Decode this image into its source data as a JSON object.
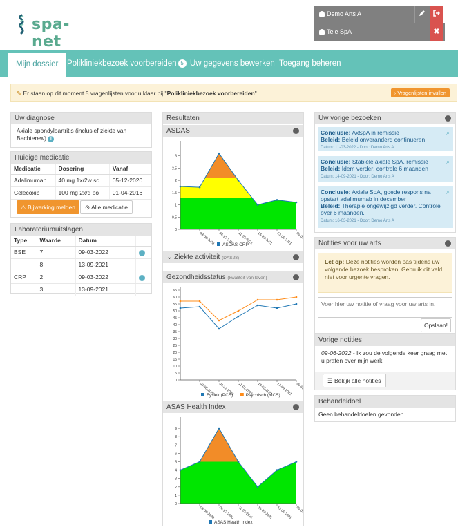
{
  "header": {
    "logo_text": "spa-net",
    "users": [
      {
        "name": "Demo Arts A",
        "actions": [
          "pencil-icon",
          "logout-icon"
        ]
      },
      {
        "name": "Tele SpA",
        "actions": [
          "close-icon"
        ]
      }
    ],
    "colors": {
      "user_bg": "#808080",
      "action_red": "#d9534f",
      "brand": "#5aaa8f"
    }
  },
  "nav": {
    "tabs": [
      {
        "label": "Mijn dossier",
        "active": true
      },
      {
        "label": "Polikliniekbezoek voorbereiden",
        "badge": "5"
      },
      {
        "label": "Uw gegevens bewerken"
      },
      {
        "label": "Toegang beheren"
      }
    ],
    "color": "#64c2b8"
  },
  "alert": {
    "text_before": "Er staan op dit moment 5 vragenlijsten voor u klaar bij \"",
    "text_bold": "Polikliniekbezoek voorbereiden",
    "text_after": "\".",
    "button": "Vragenlijsten invullen"
  },
  "diagnose": {
    "title": "Uw diagnose",
    "text": "Axiale spondyloartritis (inclusief ziekte van Bechterew)"
  },
  "medicatie": {
    "title": "Huidige medicatie",
    "headers": [
      "Medicatie",
      "Dosering",
      "Vanaf"
    ],
    "rows": [
      [
        "Adalimumab",
        "40 mg 1x/2w sc",
        "05-12-2020"
      ],
      [
        "Celecoxib",
        "100 mg 2x/d po",
        "01-04-2016"
      ]
    ],
    "btn_report": "Bijwerking melden",
    "btn_all": "Alle medicatie"
  },
  "lab": {
    "title": "Laboratoriumuitslagen",
    "headers": [
      "Type",
      "Waarde",
      "Datum"
    ],
    "rows": [
      [
        "BSE",
        "7",
        "09-03-2022"
      ],
      [
        "",
        "8",
        "13-09-2021"
      ],
      [
        "CRP",
        "2",
        "09-03-2022"
      ],
      [
        "",
        "3",
        "13-09-2021"
      ]
    ]
  },
  "results": {
    "title": "Resultaten",
    "dates": [
      "03-08-2020",
      "04-12-2020",
      "11-01-2021",
      "16-03-2021",
      "13-09-2021",
      "09-03-2022"
    ],
    "asdas_title": "ASDAS",
    "asdas_legend": "ASDAS-CRP",
    "ziekte_title": "Ziekte activiteit",
    "ziekte_sub": "(DAS28)",
    "gezondheid_title": "Gezondheidsstatus",
    "gezondheid_sub": "(kwaliteit van leven)",
    "gezondheid_legend": [
      "Fysiek (PCS)",
      "Psychisch (MCS)"
    ],
    "asas_title": "ASAS Health Index",
    "asas_legend": "ASAS Health Index"
  },
  "chart_data": [
    {
      "type": "line",
      "title": "ASDAS",
      "x": [
        "",
        "03-08-2020",
        "04-12-2020",
        "11-01-2021",
        "16-03-2021",
        "13-09-2021",
        "09-03-2022"
      ],
      "series": [
        {
          "name": "ASDAS-CRP",
          "values": [
            1.75,
            1.72,
            3.1,
            2.0,
            1.0,
            1.2,
            1.1
          ]
        }
      ],
      "ylim": [
        0,
        3.5
      ],
      "yticks": [
        0,
        0.5,
        1,
        1.5,
        2,
        2.5,
        3
      ],
      "bands": [
        {
          "from": 0,
          "to": 1.3,
          "color": "#00e600"
        },
        {
          "from": 1.3,
          "to": 2.1,
          "color": "#ffff00"
        },
        {
          "from": 2.1,
          "to": 3.5,
          "color": "#f28c28"
        }
      ],
      "colors": {
        "line": "#1f77b4"
      }
    },
    {
      "type": "line",
      "title": "Gezondheidsstatus",
      "x": [
        "",
        "03-08-2020",
        "04-12-2020",
        "11-01-2021",
        "16-03-2021",
        "13-09-2021",
        "09-03-2022"
      ],
      "series": [
        {
          "name": "Fysiek (PCS)",
          "values": [
            52,
            53,
            37,
            46,
            54,
            52,
            55
          ]
        },
        {
          "name": "Psychisch (MCS)",
          "values": [
            57,
            57,
            43,
            50,
            58,
            58,
            60
          ]
        }
      ],
      "ylim": [
        0,
        65
      ],
      "yticks": [
        0,
        5,
        10,
        15,
        20,
        25,
        30,
        35,
        40,
        45,
        50,
        55,
        60,
        65
      ],
      "colors": {
        "fysiek": "#1f77b4",
        "psychisch": "#ff8c1a"
      }
    },
    {
      "type": "area",
      "title": "ASAS Health Index",
      "x": [
        "",
        "03-08-2020",
        "04-12-2020",
        "11-01-2021",
        "16-03-2021",
        "13-09-2021",
        "09-03-2022"
      ],
      "series": [
        {
          "name": "ASAS Health Index",
          "values": [
            4,
            5,
            9,
            5,
            2,
            4,
            5
          ]
        }
      ],
      "ylim": [
        0,
        10
      ],
      "yticks": [
        0,
        1,
        2,
        3,
        4,
        5,
        6,
        7,
        8,
        9
      ],
      "bands": [
        {
          "from": 0,
          "to": 5,
          "color": "#00e600"
        },
        {
          "from": 5,
          "to": 10,
          "color": "#f28c28"
        }
      ],
      "colors": {
        "line": "#1f77b4"
      }
    }
  ],
  "bezoeken": {
    "title": "Uw vorige bezoeken",
    "items": [
      {
        "conclusie": "AxSpA in remissie",
        "beleid": "Beleid onveranderd continueren",
        "meta": "Datum: 11-03-2022 - Door: Demo Arts A"
      },
      {
        "conclusie": "Stabiele axiale SpA, remissie",
        "beleid": "Idem verder; controle 6 maanden",
        "meta": "Datum: 14-09-2021 - Door: Demo Arts A"
      },
      {
        "conclusie": "Axiale SpA, goede respons na opstart adalimumab in december",
        "beleid": "Therapie ongewijzigd verder. Controle over 6 maanden.",
        "meta": "Datum: 16-03-2021 - Door: Demo Arts A"
      }
    ],
    "label_conclusie": "Conclusie:",
    "label_beleid": "Beleid:"
  },
  "notities": {
    "title": "Notities voor uw arts",
    "note_bold": "Let op:",
    "note_text": "Deze notities worden pas tijdens uw volgende bezoek besproken. Gebruik dit veld niet voor urgente vragen.",
    "placeholder": "Voer hier uw notitie of vraag voor uw arts in.",
    "save": "Opslaan!"
  },
  "vorige_notities": {
    "title": "Vorige notities",
    "date": "09-06-2022",
    "text": "- Ik zou de volgende keer graag met u praten over mijn werk.",
    "button": "Bekijk alle notities"
  },
  "behandeldoel": {
    "title": "Behandeldoel",
    "text": "Geen behandeldoelen gevonden"
  }
}
